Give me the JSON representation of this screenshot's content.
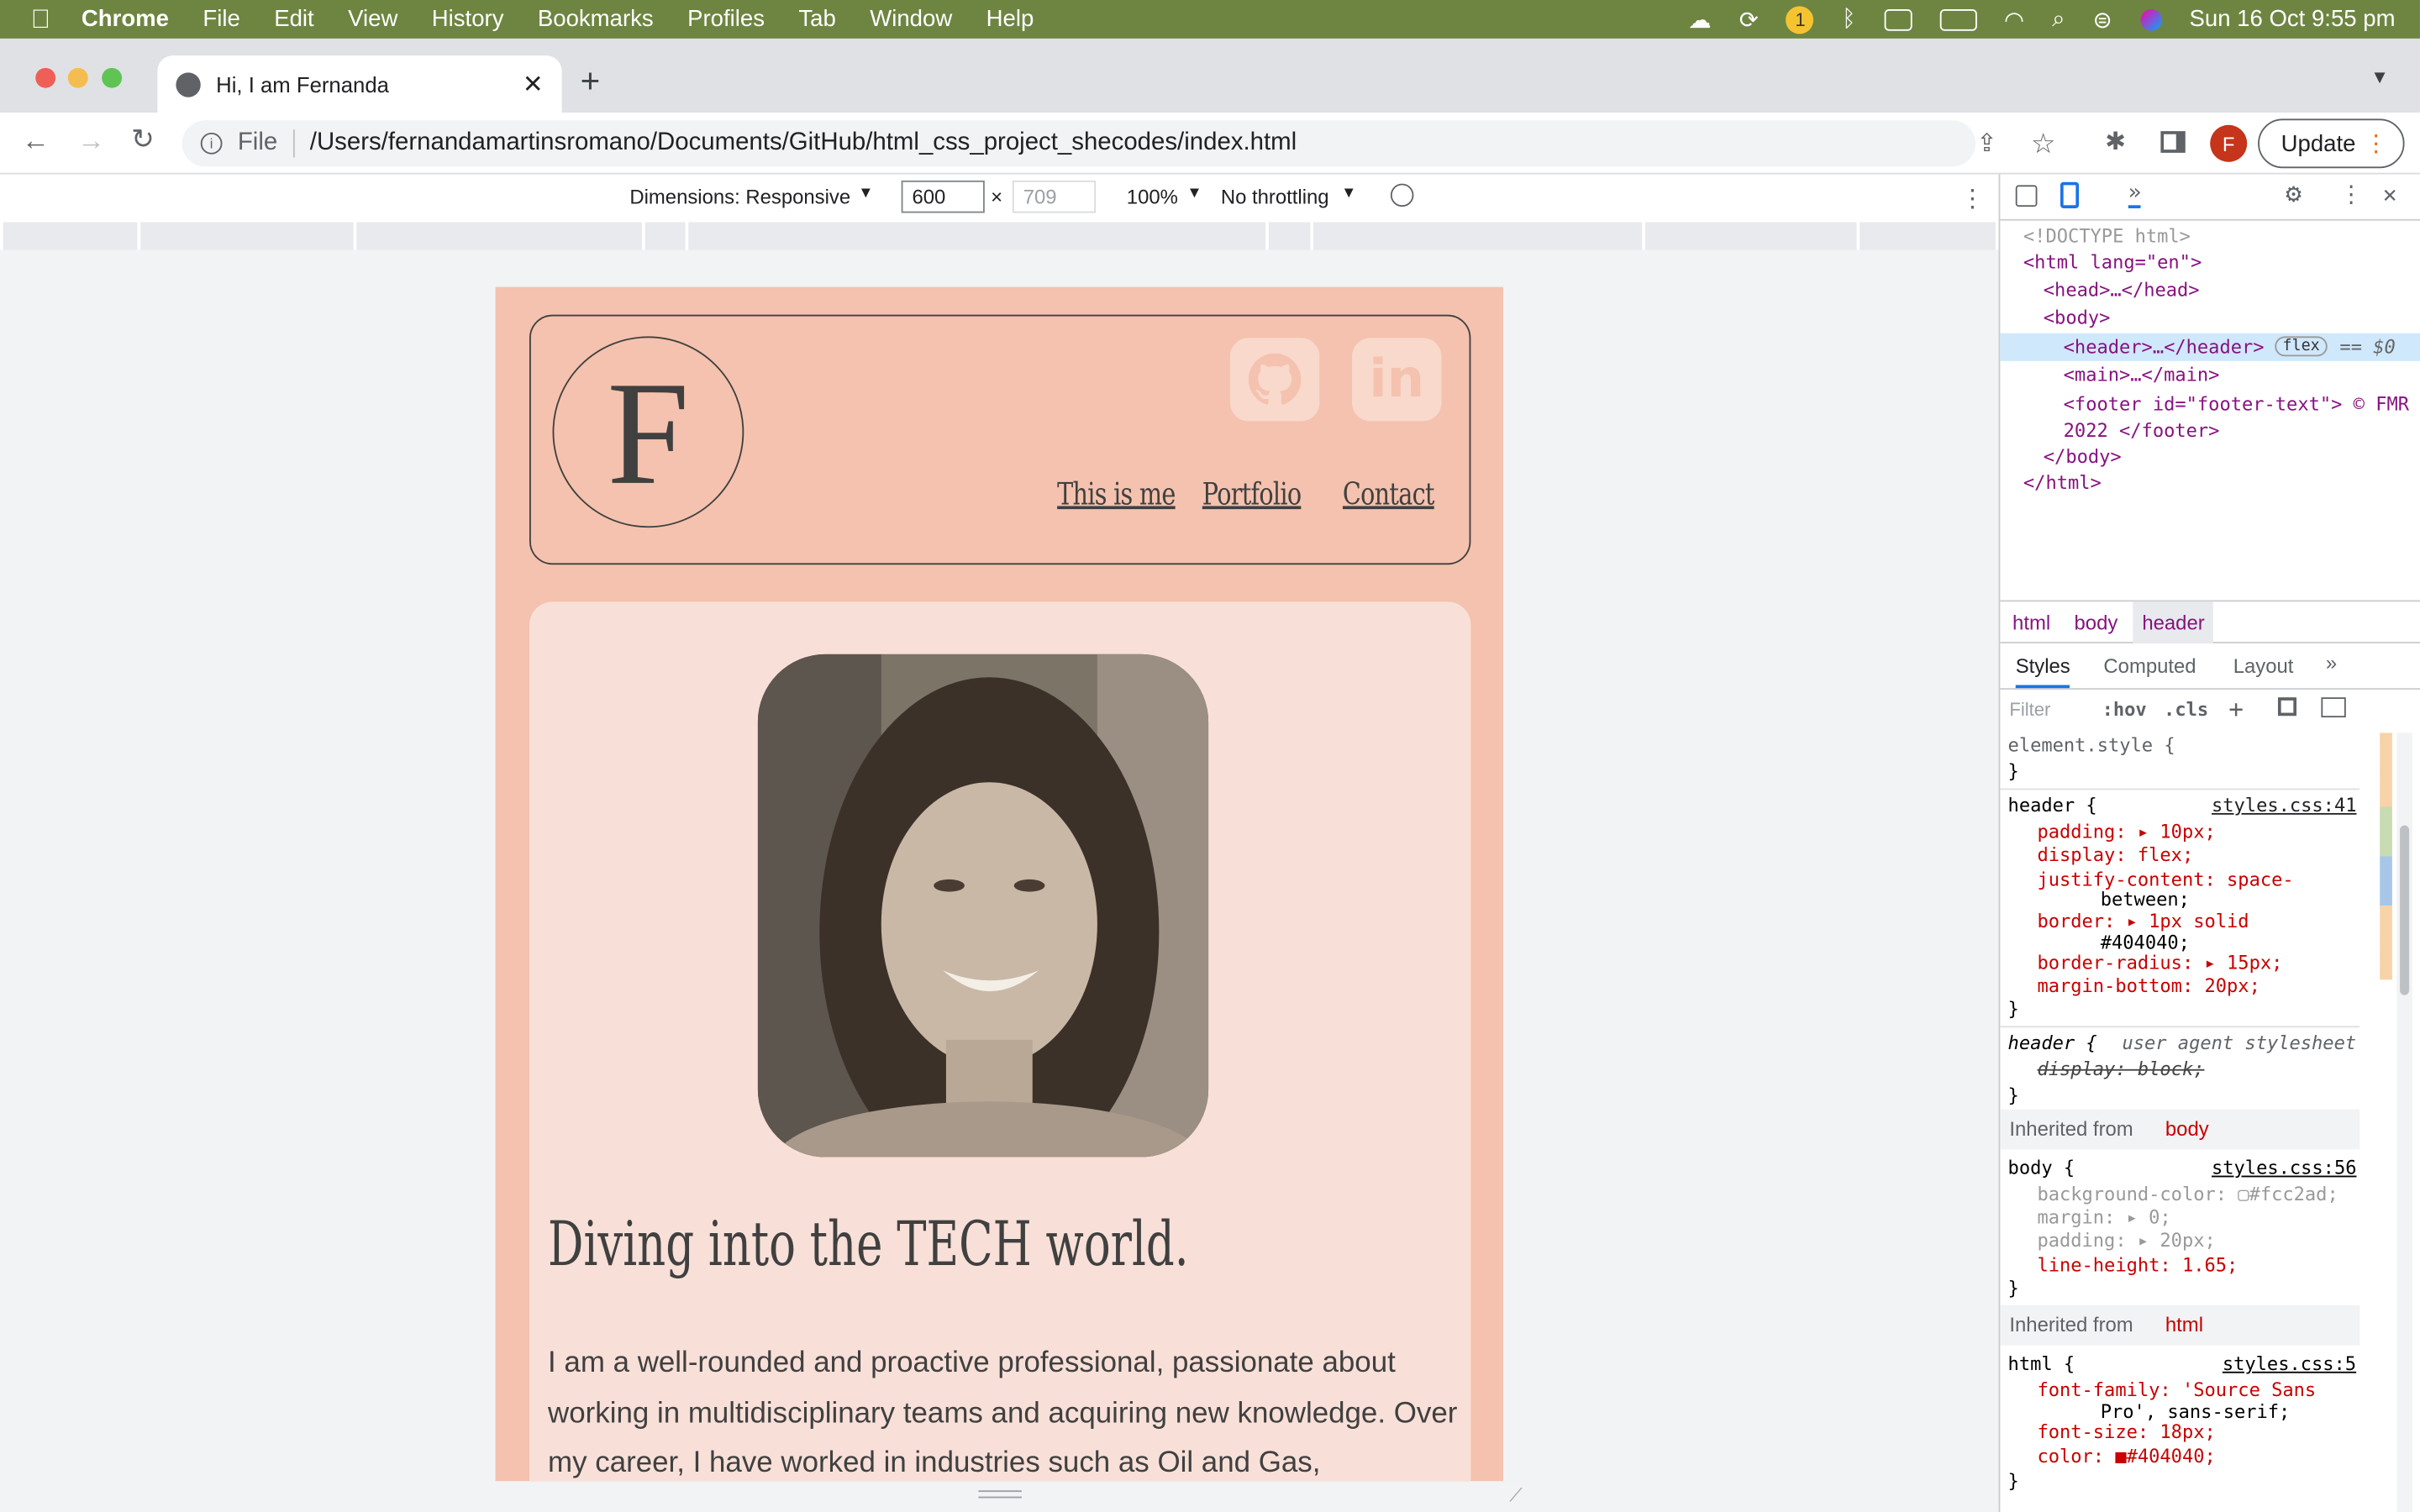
{
  "menubar": {
    "app": "Chrome",
    "items": [
      "File",
      "Edit",
      "View",
      "History",
      "Bookmarks",
      "Profiles",
      "Tab",
      "Window",
      "Help"
    ],
    "clock": "Sun 16 Oct  9:55 pm",
    "badge": "1"
  },
  "tab": {
    "title": "Hi, I am Fernanda",
    "new_tab": "+"
  },
  "address": {
    "scheme": "File",
    "url": "/Users/fernandamartinsromano/Documents/GitHub/html_css_project_shecodes/index.html",
    "update": "Update",
    "avatar": "F"
  },
  "device_toolbar": {
    "dimensions": "Dimensions: Responsive",
    "width": "600",
    "times": "×",
    "height": "709",
    "zoom": "100%",
    "throttle": "No throttling"
  },
  "site": {
    "logo": "F",
    "nav": [
      "This is me",
      "Portfolio",
      "Contact"
    ],
    "heading": "Diving into the TECH world.",
    "paragraph": "I am a well-rounded and proactive professional, passionate about working in multidisciplinary teams and acquiring new knowledge. Over my career, I have worked in industries such as Oil and Gas, Technology"
  },
  "devtools": {
    "dom": [
      "<!DOCTYPE html>",
      "<html lang=\"en\">",
      "<head>…</head>",
      "<body>",
      "<header>…</header>",
      "flex",
      "== $0",
      "<main>…</main>",
      "<footer id=\"footer-text\"> © FMR",
      "2022 </footer>",
      "</body>",
      "</html>"
    ],
    "breadcrumbs": [
      "html",
      "body",
      "header"
    ],
    "tabs": [
      "Styles",
      "Computed",
      "Layout"
    ],
    "filter": "Filter",
    "hov": ":hov",
    "cls": ".cls",
    "styles": [
      {
        "selector": "element.style {",
        "source": "",
        "props": []
      },
      {
        "selector": "header {",
        "source": "styles.css:41",
        "props": [
          "padding: ▸ 10px;",
          "display: flex;",
          "justify-content: space-",
          "between;",
          "border: ▸ 1px solid",
          "#404040;",
          "border-radius: ▸ 15px;",
          "margin-bottom: 20px;"
        ]
      },
      {
        "selector": "header {",
        "source": "user agent stylesheet",
        "props": [
          "display: block;"
        ]
      },
      {
        "selector": "body {",
        "source": "styles.css:56",
        "props": [
          "background-color: ▢#fcc2ad;",
          "margin: ▸ 0;",
          "padding: ▸ 20px;",
          "line-height: 1.65;"
        ]
      },
      {
        "selector": "html {",
        "source": "styles.css:5",
        "props": [
          "font-family: 'Source Sans",
          "Pro', sans-serif;",
          "font-size: 18px;",
          "color: ■#404040;"
        ]
      }
    ],
    "inherited_body": "Inherited from",
    "inherited_body_tag": "body",
    "inherited_html_tag": "html",
    "close": "}"
  }
}
